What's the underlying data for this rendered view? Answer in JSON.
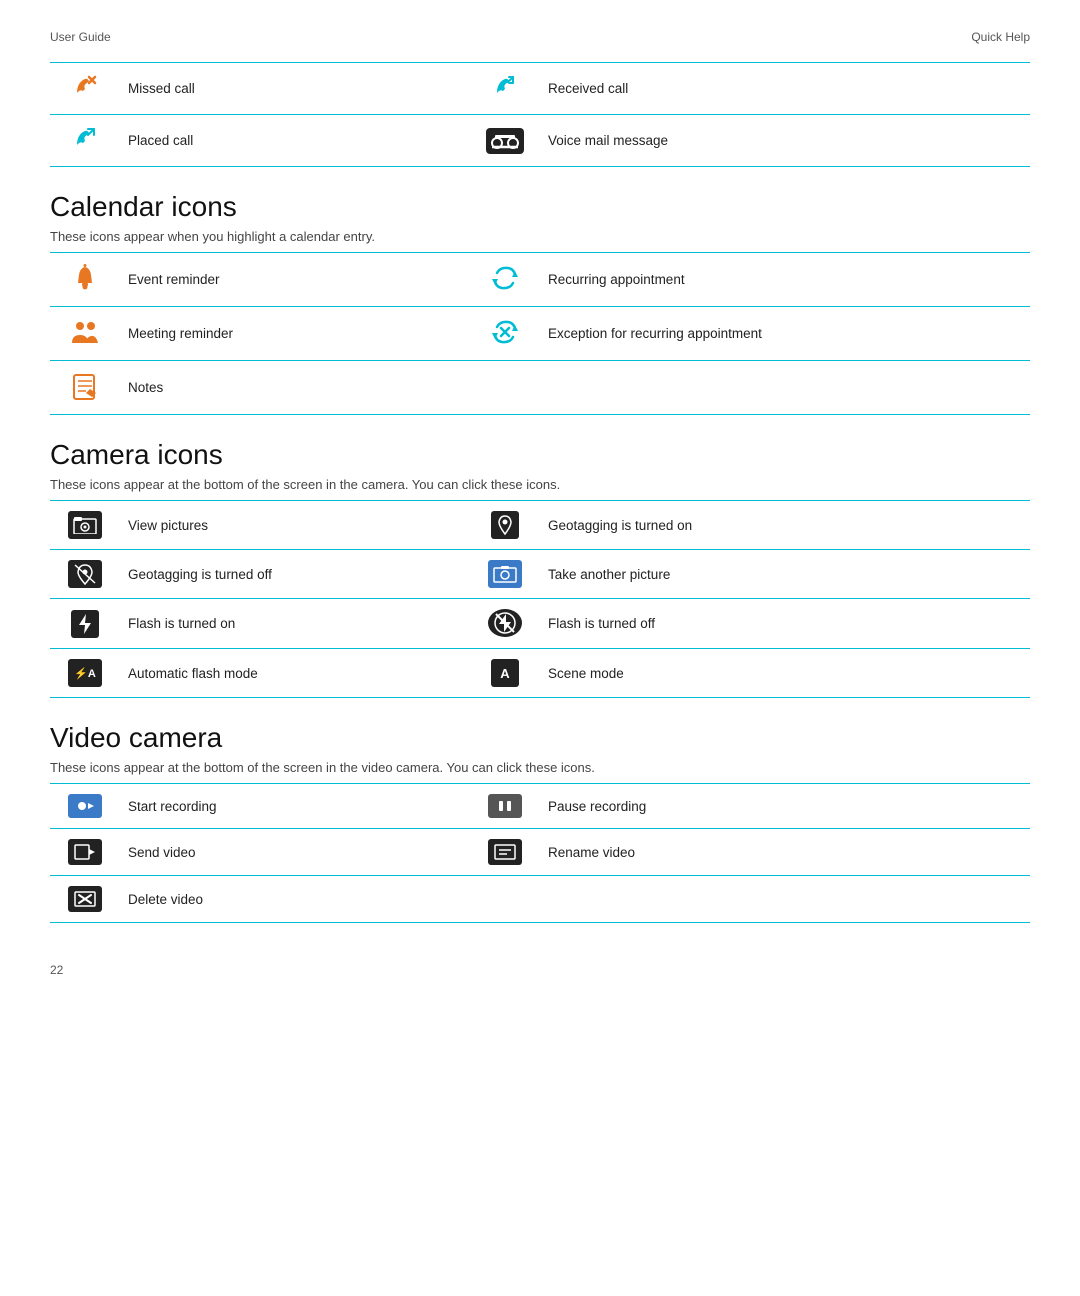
{
  "header": {
    "left": "User Guide",
    "right": "Quick Help"
  },
  "footer": {
    "page": "22"
  },
  "call_table": {
    "rows": [
      {
        "icon1_name": "missed-call-icon",
        "icon1_symbol": "phone-missed",
        "label1": "Missed call",
        "icon2_name": "received-call-icon",
        "icon2_symbol": "phone-received",
        "label2": "Received call"
      },
      {
        "icon1_name": "placed-call-icon",
        "icon1_symbol": "phone-placed",
        "label1": "Placed call",
        "icon2_name": "voicemail-icon",
        "icon2_symbol": "voicemail",
        "label2": "Voice mail message"
      }
    ]
  },
  "calendar_section": {
    "title": "Calendar icons",
    "description": "These icons appear when you highlight a calendar entry.",
    "rows": [
      {
        "icon1_name": "event-reminder-icon",
        "label1": "Event reminder",
        "icon2_name": "recurring-appointment-icon",
        "label2": "Recurring appointment"
      },
      {
        "icon1_name": "meeting-reminder-icon",
        "label1": "Meeting reminder",
        "icon2_name": "exception-recurring-icon",
        "label2": "Exception for recurring appointment"
      },
      {
        "icon1_name": "notes-icon",
        "label1": "Notes",
        "icon2_name": "",
        "label2": ""
      }
    ]
  },
  "camera_section": {
    "title": "Camera icons",
    "description": "These icons appear at the bottom of the screen in the camera. You can click these icons.",
    "rows": [
      {
        "icon1_name": "view-pictures-icon",
        "label1": "View pictures",
        "icon2_name": "geotagging-on-icon",
        "label2": "Geotagging is turned on"
      },
      {
        "icon1_name": "geotagging-off-icon",
        "label1": "Geotagging is turned off",
        "icon2_name": "take-picture-icon",
        "label2": "Take another picture"
      },
      {
        "icon1_name": "flash-on-icon",
        "label1": "Flash is turned on",
        "icon2_name": "flash-off-icon",
        "label2": "Flash is turned off"
      },
      {
        "icon1_name": "auto-flash-icon",
        "label1": "Automatic flash mode",
        "icon2_name": "scene-mode-icon",
        "label2": "Scene mode"
      }
    ]
  },
  "video_section": {
    "title": "Video camera",
    "description": "These icons appear at the bottom of the screen in the video camera. You can click these icons.",
    "rows": [
      {
        "icon1_name": "start-recording-icon",
        "label1": "Start recording",
        "icon2_name": "pause-recording-icon",
        "label2": "Pause recording"
      },
      {
        "icon1_name": "send-video-icon",
        "label1": "Send video",
        "icon2_name": "rename-video-icon",
        "label2": "Rename video"
      },
      {
        "icon1_name": "delete-video-icon",
        "label1": "Delete video",
        "icon2_name": "",
        "label2": ""
      }
    ]
  }
}
